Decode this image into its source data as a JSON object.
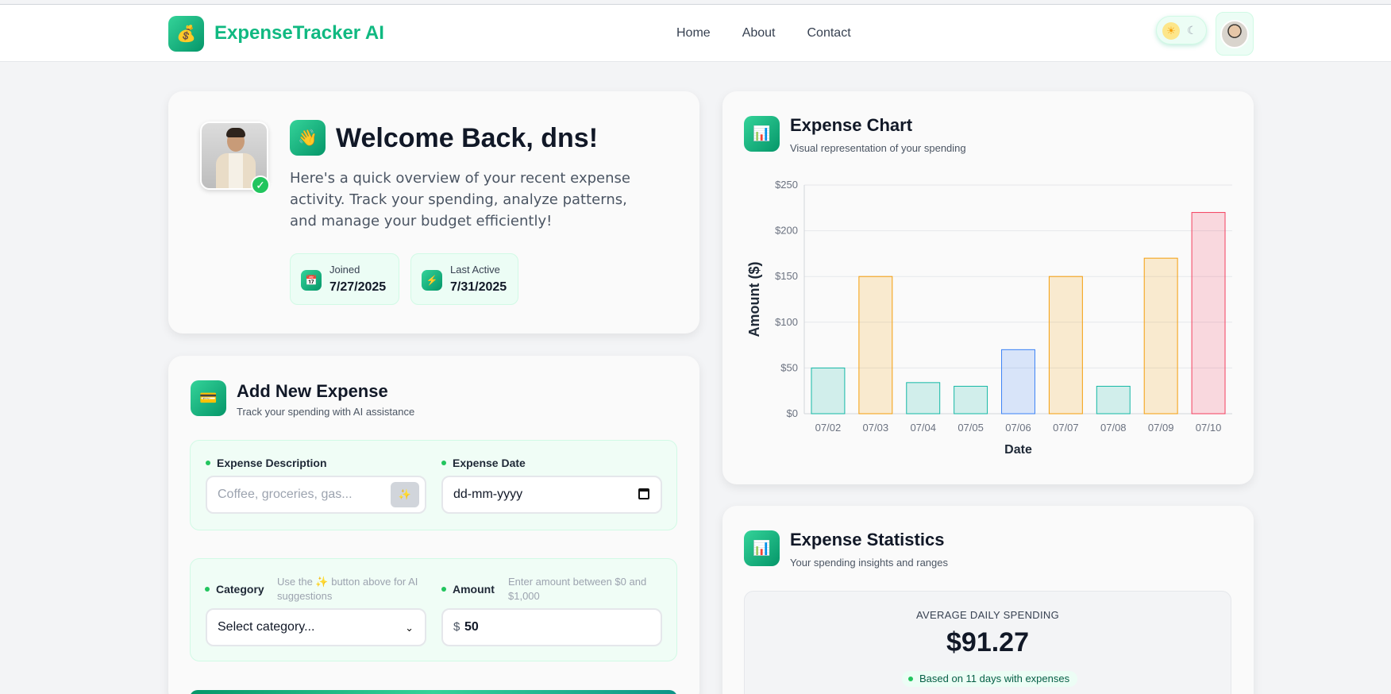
{
  "nav": {
    "brand": "ExpenseTracker AI",
    "logo_icon": "money-bag-icon",
    "links": [
      "Home",
      "About",
      "Contact"
    ],
    "theme_sun": "☀",
    "theme_moon": "☾"
  },
  "welcome": {
    "title": "Welcome Back, dns!",
    "wave": "👋",
    "description": "Here's a quick overview of your recent expense activity. Track your spending, analyze patterns, and manage your budget efficiently!",
    "verified": "✓",
    "joined_label": "Joined",
    "joined_value": "7/27/2025",
    "last_active_label": "Last Active",
    "last_active_value": "7/31/2025"
  },
  "add_expense": {
    "title": "Add New Expense",
    "subtitle": "Track your spending with AI assistance",
    "description_label": "Expense Description",
    "description_placeholder": "Coffee, groceries, gas...",
    "sparkle": "✨",
    "date_label": "Expense Date",
    "date_placeholder": "dd-mm-yyyy",
    "category_label": "Category",
    "category_hint": "Use the ✨ button above for AI suggestions",
    "category_value": "Select category...",
    "amount_label": "Amount",
    "amount_hint": "Enter amount between $0 and $1,000",
    "amount_prefix": "$",
    "amount_value": "50"
  },
  "chart": {
    "title": "Expense Chart",
    "subtitle": "Visual representation of your spending"
  },
  "chart_data": {
    "type": "bar",
    "categories": [
      "07/02",
      "07/03",
      "07/04",
      "07/05",
      "07/06",
      "07/07",
      "07/08",
      "07/09",
      "07/10"
    ],
    "values": [
      50,
      150,
      34,
      30,
      70,
      150,
      30,
      170,
      220
    ],
    "bar_colors": [
      "#14b8a6",
      "#f59e0b",
      "#14b8a6",
      "#14b8a6",
      "#3b82f6",
      "#f59e0b",
      "#14b8a6",
      "#f59e0b",
      "#f43f5e"
    ],
    "yticks": [
      "$0",
      "$50",
      "$100",
      "$150",
      "$200",
      "$250"
    ],
    "ylim": [
      0,
      250
    ],
    "xlabel": "Date",
    "ylabel": "Amount ($)",
    "grid": true
  },
  "stats": {
    "title": "Expense Statistics",
    "subtitle": "Your spending insights and ranges",
    "avg_label": "AVERAGE DAILY SPENDING",
    "avg_value": "$91.27",
    "avg_note": "Based on 11 days with expenses"
  }
}
